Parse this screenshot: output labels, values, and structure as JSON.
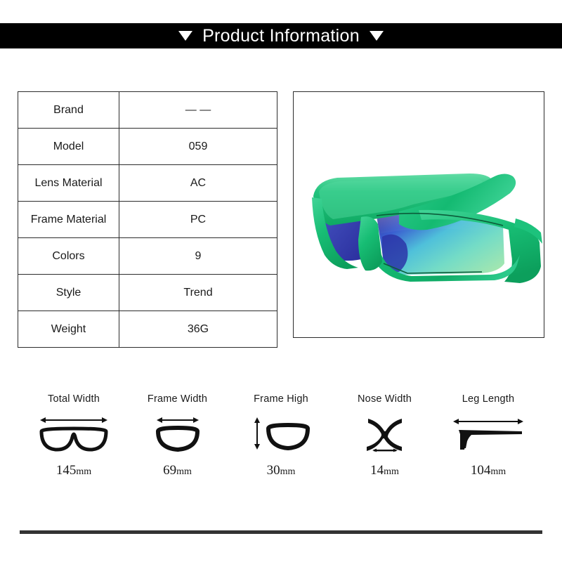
{
  "header": {
    "title": "Product Information",
    "left_marker": "triangle-down",
    "right_marker": "triangle-down",
    "background_color": "#000000",
    "text_color": "#ffffff"
  },
  "spec_table": {
    "rows": [
      {
        "label": "Brand",
        "value": "— —"
      },
      {
        "label": "Model",
        "value": "059"
      },
      {
        "label": "Lens Material",
        "value": "AC"
      },
      {
        "label": "Frame Material",
        "value": "PC"
      },
      {
        "label": "Colors",
        "value": "9"
      },
      {
        "label": "Style",
        "value": "Trend"
      },
      {
        "label": "Weight",
        "value": "36G"
      }
    ]
  },
  "product_image": {
    "alt": "Green wraparound sport sunglasses with iridescent blue-green mirrored lens",
    "frame_color": "#18be77",
    "frame_highlight_color": "#5ddba4",
    "frame_shadow_color": "#0a9a5c",
    "lens_colors": [
      "#2b2f9e",
      "#3f6fd8",
      "#4fc8d8",
      "#6fe0c0",
      "#9fe8b0"
    ],
    "background_color": "#ffffff"
  },
  "measurements": [
    {
      "title": "Total Width",
      "value": "145",
      "unit": "mm",
      "icon": "glasses-full-width-icon"
    },
    {
      "title": "Frame Width",
      "value": "69",
      "unit": "mm",
      "icon": "lens-width-icon"
    },
    {
      "title": "Frame High",
      "value": "30",
      "unit": "mm",
      "icon": "lens-height-icon"
    },
    {
      "title": "Nose Width",
      "value": "14",
      "unit": "mm",
      "icon": "nose-bridge-icon"
    },
    {
      "title": "Leg Length",
      "value": "104",
      "unit": "mm",
      "icon": "temple-arm-icon"
    }
  ],
  "footer": {
    "rule_color": "#333333"
  }
}
